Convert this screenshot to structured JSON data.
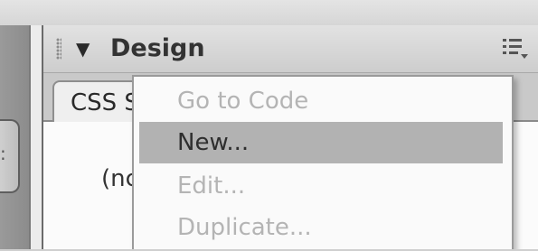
{
  "panel": {
    "title": "Design",
    "collapse_icon": "triangle-down-icon",
    "options_icon": "panel-options-icon",
    "active_tab_label": "CSS S",
    "body_text": "(nc"
  },
  "context_menu": {
    "items": [
      {
        "label": "Go to Code",
        "enabled": false,
        "highlighted": false
      },
      {
        "label": "New...",
        "enabled": true,
        "highlighted": true
      },
      {
        "label": "Edit...",
        "enabled": false,
        "highlighted": false
      },
      {
        "label": "Duplicate...",
        "enabled": false,
        "highlighted": false
      }
    ]
  },
  "colors": {
    "highlight": "#b2b2b2",
    "disabled_text": "#b4b4b4",
    "header": "#cdcdcd"
  }
}
